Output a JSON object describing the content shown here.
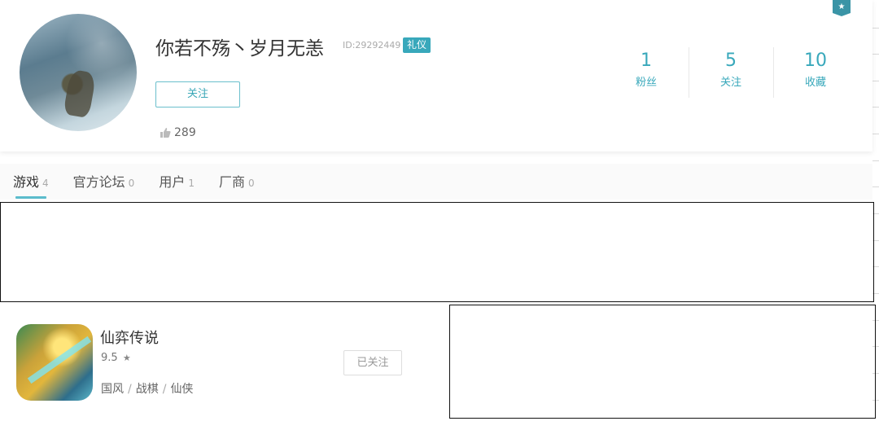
{
  "profile": {
    "username": "你若不殇丶岁月无恙",
    "id_text": "ID:29292449",
    "badge": "礼仪",
    "follow_label": "关注",
    "likes": "289",
    "stats": [
      {
        "value": "1",
        "label": "粉丝"
      },
      {
        "value": "5",
        "label": "关注"
      },
      {
        "value": "10",
        "label": "收藏"
      }
    ],
    "corner_badge_icon": "star-icon"
  },
  "tabs": [
    {
      "label": "游戏",
      "count": "4",
      "active": true
    },
    {
      "label": "官方论坛",
      "count": "0"
    },
    {
      "label": "用户",
      "count": "1"
    },
    {
      "label": "厂商",
      "count": "0"
    }
  ],
  "games": [
    {
      "title": "仙弈传说",
      "rating": "9.5",
      "tags": [
        "国风",
        "战棋",
        "仙侠"
      ],
      "button_label": "已关注"
    }
  ],
  "colors": {
    "accent": "#38a8bb"
  }
}
